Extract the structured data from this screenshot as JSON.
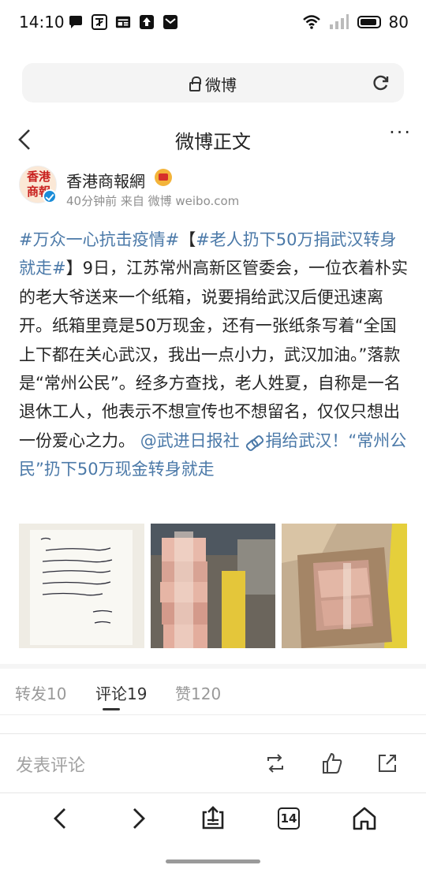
{
  "status_bar": {
    "time": "14:10",
    "notif_icons": [
      "chat-bubble-icon",
      "translate-icon",
      "news-icon",
      "upload-icon",
      "mail-icon"
    ],
    "battery": "80"
  },
  "browser": {
    "url_title": "微博"
  },
  "header": {
    "title": "微博正文",
    "more": "···"
  },
  "author": {
    "avatar_text": "香港\n商報",
    "name": "香港商報網",
    "meta": "40分钟前 来自 微博 weibo.com"
  },
  "post": {
    "tag1": "#万众一心抗击疫情#",
    "bracket_open": "【",
    "tag2": "#老人扔下50万捐武汉转身就走#",
    "body1": "】9日，江苏常州高新区管委会，一位衣着朴实的老大爷送来一个纸箱，说要捐给武汉后便迅速离开。纸箱里竟是50万现金，还有一张纸条写着“全国上下都在关心武汉，我出一点小力，武汉加油。”落款是“常州公民”。经多方查找，老人姓夏，自称是一名退休工人，他表示不想宣传也不想留名，仅仅只想出一份爱心之力。",
    "mention": "@武进日报社",
    "article_link": "捐给武汉！“常州公民”扔下50万现金转身就走"
  },
  "photos": [
    {
      "name": "handwritten-note-photo"
    },
    {
      "name": "cash-stacks-photo"
    },
    {
      "name": "cash-box-photo"
    }
  ],
  "tabs": {
    "repost": "转发10",
    "comment": "评论19",
    "like": "赞120"
  },
  "comment_bar": {
    "placeholder": "发表评论"
  },
  "nav": {
    "tab_count": "14"
  },
  "colors": {
    "link": "#4b79a8",
    "text": "#262626",
    "meta": "#8f8f8f"
  }
}
